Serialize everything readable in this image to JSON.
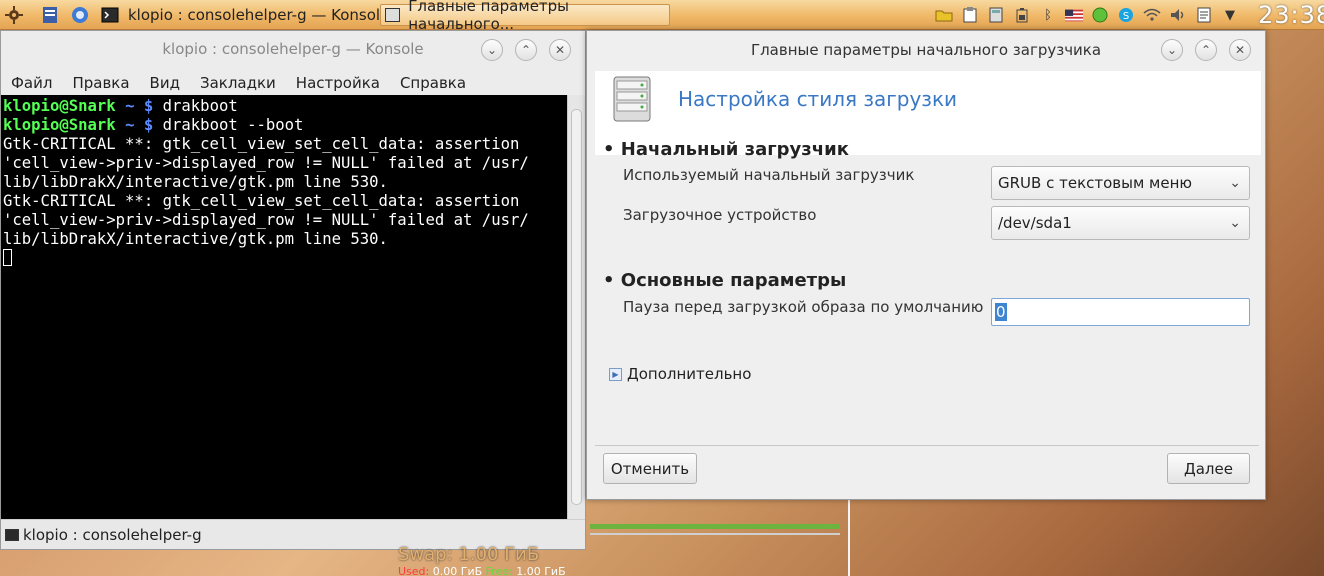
{
  "taskbar": {
    "task_konsole": "klopio : consolehelper-g — Konsole",
    "task_dialog": "Главные параметры начального...",
    "clock": "23:38"
  },
  "konsole": {
    "title": "klopio : consolehelper-g — Konsole",
    "menu": [
      "Файл",
      "Правка",
      "Вид",
      "Закладки",
      "Настройка",
      "Справка"
    ],
    "prompt_user": "klopio@Snark",
    "prompt_tilde": "~",
    "prompt_dollar": "$",
    "cmd1": "drakboot",
    "cmd2": "drakboot --boot",
    "output": [
      "Gtk-CRITICAL **: gtk_cell_view_set_cell_data: assertion",
      "'cell_view->priv->displayed_row != NULL' failed at /usr/",
      "lib/libDrakX/interactive/gtk.pm line 530.",
      "Gtk-CRITICAL **: gtk_cell_view_set_cell_data: assertion",
      "'cell_view->priv->displayed_row != NULL' failed at /usr/",
      "lib/libDrakX/interactive/gtk.pm line 530."
    ],
    "tab_label": "klopio : consolehelper-g"
  },
  "dialog": {
    "title": "Главные параметры начального загрузчика",
    "header_title": "Настройка стиля загрузки",
    "section1": "• Начальный загрузчик",
    "bootloader_label": "Используемый начальный загрузчик",
    "bootloader_value": "GRUB с текстовым меню",
    "device_label": "Загрузочное устройство",
    "device_value": "/dev/sda1",
    "section2": "• Основные параметры",
    "pause_label": "Пауза перед загрузкой образа по умолчанию",
    "pause_value": "0",
    "advanced": "Дополнительно",
    "cancel": "Отменить",
    "next": "Далее"
  },
  "desktop": {
    "swap_text": "Swap: 1.00 ГиБ",
    "used_label": "Used:",
    "used_value": "0.00 ГиБ",
    "free_label": "Free:",
    "free_value": "1.00 ГиБ"
  }
}
